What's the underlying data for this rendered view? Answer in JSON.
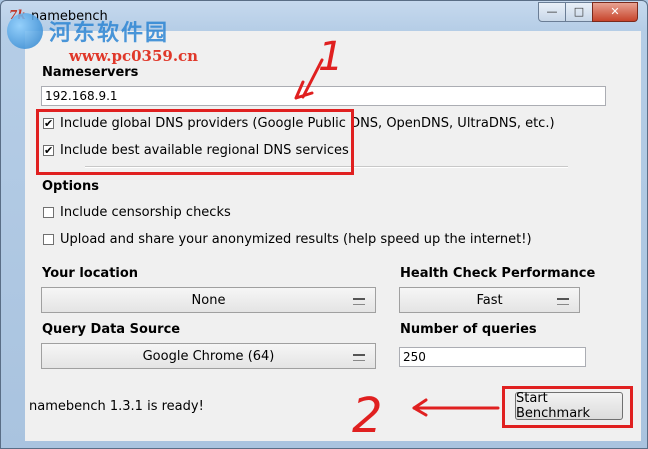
{
  "window": {
    "title": "namebench",
    "icon_text": "7k",
    "controls": {
      "minimize": "—",
      "maximize": "□",
      "close": "✕"
    }
  },
  "watermark": {
    "text": "河东软件园",
    "url": "www.pc0359.cn"
  },
  "nameservers": {
    "label": "Nameservers",
    "value": "192.168.9.1",
    "include_global": {
      "label": "Include global DNS providers (Google Public DNS, OpenDNS, UltraDNS, etc.)",
      "checked": true
    },
    "include_regional": {
      "label": "Include best available regional DNS services",
      "checked": true
    }
  },
  "options": {
    "label": "Options",
    "censorship": {
      "label": "Include censorship checks",
      "checked": false
    },
    "upload": {
      "label": "Upload and share your anonymized results (help speed up the internet!)",
      "checked": false
    }
  },
  "location": {
    "label": "Your location",
    "value": "None"
  },
  "health": {
    "label": "Health Check Performance",
    "value": "Fast"
  },
  "query_source": {
    "label": "Query Data Source",
    "value": "Google Chrome (64)"
  },
  "queries": {
    "label": "Number of queries",
    "value": "250"
  },
  "status": "namebench 1.3.1 is ready!",
  "start_button": "Start Benchmark",
  "annotations": {
    "one": "1",
    "two": "2",
    "color": "#e02020"
  }
}
